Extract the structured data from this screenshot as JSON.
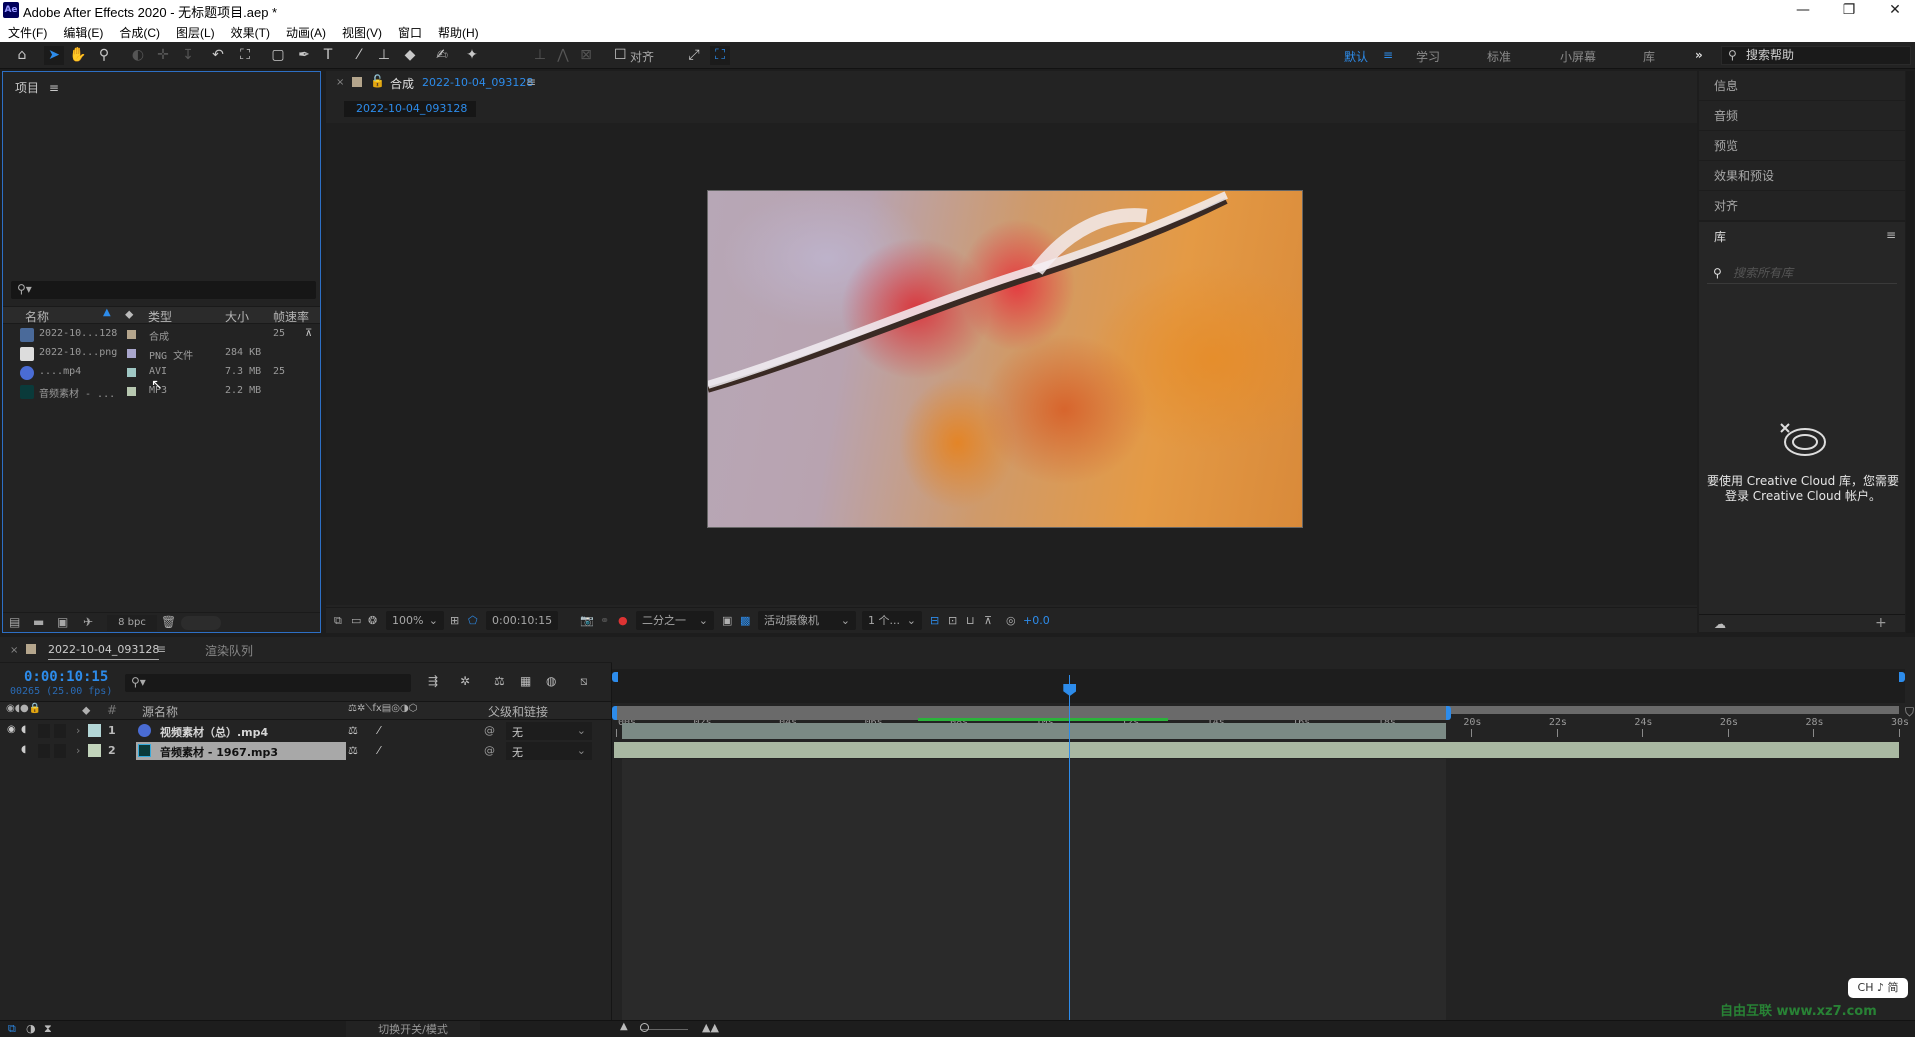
{
  "window": {
    "app_icon": "Ae",
    "title": "Adobe After Effects 2020 - 无标题项目.aep *",
    "controls": {
      "minimize": "—",
      "restore": "❐",
      "close": "✕"
    }
  },
  "menu": [
    "文件(F)",
    "编辑(E)",
    "合成(C)",
    "图层(L)",
    "效果(T)",
    "动画(A)",
    "视图(V)",
    "窗口",
    "帮助(H)"
  ],
  "toolbar": {
    "tools": [
      "home-icon",
      "selection-icon",
      "hand-icon",
      "zoom-icon",
      "orbit-icon",
      "pan-icon",
      "dolly-icon",
      "rotate-icon",
      "anchor-icon",
      "rectangle-icon",
      "pen-icon",
      "text-icon",
      "brush-icon",
      "clone-stamp-icon",
      "eraser-icon",
      "roto-brush-icon",
      "puppet-pin-icon"
    ],
    "snap_label": "对齐",
    "workspaces": [
      {
        "label": "默认",
        "active": true
      },
      {
        "label": "学习",
        "active": false
      },
      {
        "label": "标准",
        "active": false
      },
      {
        "label": "小屏幕",
        "active": false
      },
      {
        "label": "库",
        "active": false
      }
    ],
    "overflow": "»",
    "help_search_placeholder": "搜索帮助"
  },
  "project_panel": {
    "title": "项目",
    "columns": {
      "name": "名称",
      "type": "类型",
      "size": "大小",
      "fps": "帧速率"
    },
    "items": [
      {
        "icon": "composition-icon",
        "name": "2022-10...128",
        "color": "#b4a58c",
        "type": "合成",
        "size": "",
        "fps": "25"
      },
      {
        "icon": "png-file-icon",
        "name": "2022-10...png",
        "color": "#a9a6cc",
        "type": "PNG 文件",
        "size": "284 KB",
        "fps": ""
      },
      {
        "icon": "video-file-icon",
        "name": "....mp4",
        "color": "#9fc7c4",
        "type": "AVI",
        "size": "7.3 MB",
        "fps": "25"
      },
      {
        "icon": "audio-file-icon",
        "name": "音频素材 - ...",
        "color": "#b7c8b0",
        "type": "MP3",
        "size": "2.2 MB",
        "fps": ""
      }
    ],
    "bpc": "8 bpc"
  },
  "composition_panel": {
    "tab_prefix": "合成",
    "comp_name": "2022-10-04_093128",
    "breadcrumb": "2022-10-04_093128",
    "zoom": "100%",
    "timecode": "0:00:10:15",
    "resolution": "二分之一",
    "camera": "活动摄像机",
    "views": "1 个...",
    "exposure": "+0.0"
  },
  "right_panel": {
    "items": [
      "信息",
      "音频",
      "预览",
      "效果和预设",
      "对齐"
    ],
    "library": {
      "title": "库",
      "search_placeholder": "搜索所有库",
      "message": "要使用 Creative Cloud 库，您需要登录 Creative Cloud 帐户。"
    }
  },
  "timeline": {
    "comp_tab": "2022-10-04_093128",
    "render_queue_tab": "渲染队列",
    "current_time": "0:00:10:15",
    "frame_info": "00265 (25.00 fps)",
    "columns": {
      "num": "#",
      "source_name": "源名称",
      "parent": "父级和链接"
    },
    "layers": [
      {
        "num": "1",
        "icon": "video-file-icon",
        "name": "视频素材（总）.mp4",
        "color": "#b3d6d6",
        "parent": "无",
        "selected": false
      },
      {
        "num": "2",
        "icon": "audio-file-icon",
        "name": "音频素材 - 1967.mp3",
        "color": "#c2d4bb",
        "parent": "无",
        "selected": true
      }
    ],
    "ruler_ticks": [
      "00s",
      "02s",
      "04s",
      "06s",
      "08s",
      "10s",
      "12s",
      "14s",
      "16s",
      "18s",
      "20s",
      "22s",
      "24s",
      "26s",
      "28s",
      "30s"
    ],
    "duration_seconds": 30,
    "playhead_seconds": 10.6,
    "work_area_end_seconds": 19.4,
    "video_layer_end_seconds": 19.4,
    "audio_layer_end_seconds": 30,
    "toggle_label": "切换开关/模式"
  },
  "overlay": {
    "ime": "CH ♪ 简",
    "watermark": "自由互联 www.xz7.com"
  }
}
